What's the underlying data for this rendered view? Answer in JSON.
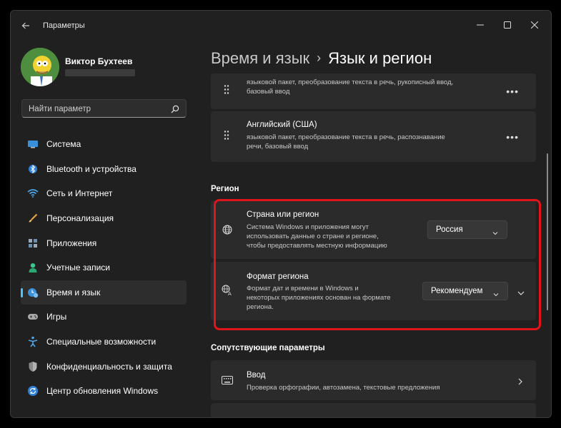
{
  "window": {
    "title": "Параметры"
  },
  "user": {
    "name": "Виктор Бухтеев"
  },
  "search": {
    "placeholder": "Найти параметр"
  },
  "nav": {
    "items": [
      {
        "label": "Система",
        "icon": "system-icon"
      },
      {
        "label": "Bluetooth и устройства",
        "icon": "bluetooth-icon"
      },
      {
        "label": "Сеть и Интернет",
        "icon": "wifi-icon"
      },
      {
        "label": "Персонализация",
        "icon": "brush-icon"
      },
      {
        "label": "Приложения",
        "icon": "apps-icon"
      },
      {
        "label": "Учетные записи",
        "icon": "person-icon"
      },
      {
        "label": "Время и язык",
        "icon": "time-language-icon",
        "active": true
      },
      {
        "label": "Игры",
        "icon": "gamepad-icon"
      },
      {
        "label": "Специальные возможности",
        "icon": "accessibility-icon"
      },
      {
        "label": "Конфиденциальность и защита",
        "icon": "shield-icon"
      },
      {
        "label": "Центр обновления Windows",
        "icon": "update-icon"
      }
    ]
  },
  "breadcrumb": {
    "parent": "Время и язык",
    "current": "Язык и регион"
  },
  "languages": [
    {
      "desc_line1": "языковой пакет, преобразование текста в речь, рукописный ввод,",
      "desc_line2": "базовый ввод"
    },
    {
      "title": "Английский (США)",
      "desc_line1": "языковой пакет, преобразование текста в речь, распознавание",
      "desc_line2": "речи, базовый ввод"
    }
  ],
  "region": {
    "section_title": "Регион",
    "country": {
      "title": "Страна или регион",
      "desc_line1": "Система Windows и приложения могут",
      "desc_line2": "использовать данные о стране и регионе,",
      "desc_line3": "чтобы предоставлять местную информацию",
      "value": "Россия"
    },
    "format": {
      "title": "Формат региона",
      "desc_line1": "Формат дат и времени в Windows и",
      "desc_line2": "некоторых приложениях основан на формате",
      "desc_line3": "региона.",
      "value": "Рекомендуем"
    }
  },
  "related": {
    "section_title": "Сопутствующие параметры",
    "input": {
      "title": "Ввод",
      "desc": "Проверка орфографии, автозамена, текстовые предложения"
    }
  },
  "colors": {
    "accent": "#4cc2ff",
    "highlight": "#e0151c",
    "background": "#202020",
    "card": "#2b2b2b"
  }
}
